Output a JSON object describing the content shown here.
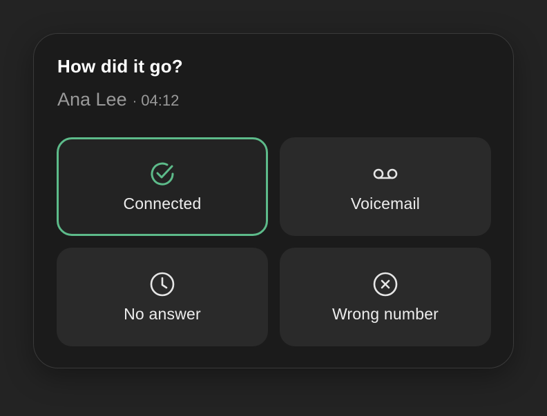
{
  "dialog": {
    "title": "How did it go?",
    "contact_name": "Ana Lee",
    "separator": "·",
    "duration": "04:12"
  },
  "options": [
    {
      "label": "Connected",
      "icon": "check-circle-icon",
      "selected": true
    },
    {
      "label": "Voicemail",
      "icon": "voicemail-icon",
      "selected": false
    },
    {
      "label": "No answer",
      "icon": "clock-icon",
      "selected": false
    },
    {
      "label": "Wrong number",
      "icon": "x-circle-icon",
      "selected": false
    }
  ],
  "colors": {
    "accent": "#5dbb8a",
    "background": "#232323",
    "card": "#1b1b1b",
    "option": "#2a2a2a",
    "muted_text": "#9a9a9a"
  }
}
